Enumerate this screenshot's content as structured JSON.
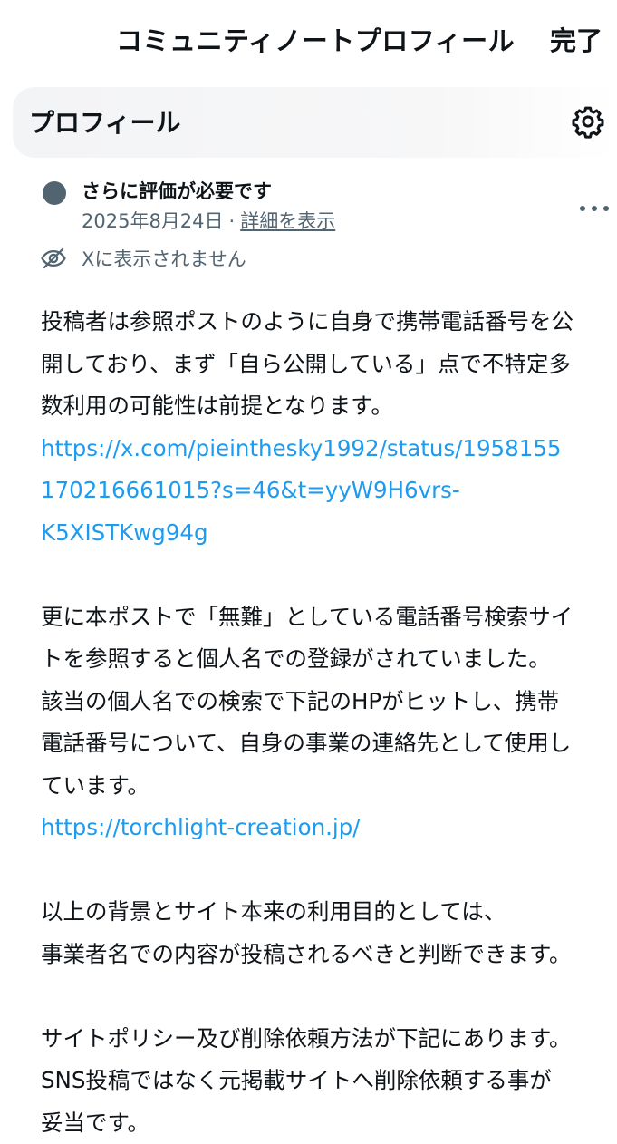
{
  "header": {
    "title": "コミュニティノートプロフィール",
    "done_label": "完了"
  },
  "profile": {
    "title": "プロフィール"
  },
  "note": {
    "status": "さらに評価が必要です",
    "date": "2025年8月24日",
    "separator": "·",
    "details_link": "詳細を表示",
    "visibility": "Xに表示されません",
    "body": {
      "p1": [
        "投稿者は参照ポストのように自身で携帯電話番号を公",
        "開しており、まず「自ら公開している」点で不特定多",
        "数利用の可能性は前提となります。"
      ],
      "link1": [
        "https://x.com/pieinthesky1992/status/1958155",
        "170216661015?s=46&t=yyW9H6vrs-",
        "K5XISTKwg94g"
      ],
      "p2": [
        "更に本ポストで「無難」としている電話番号検索サイ",
        "トを参照すると個人名での登録がされていました。",
        "該当の個人名での検索で下記のHPがヒットし、携帯",
        "電話番号について、自身の事業の連絡先として使用し",
        "ています。"
      ],
      "link2": "https://torchlight-creation.jp/",
      "p3": [
        "以上の背景とサイト本来の利用目的としては、",
        "事業者名での内容が投稿されるべきと判断できます。"
      ],
      "p4": [
        "サイトポリシー及び削除依頼方法が下記にあります。",
        "SNS投稿ではなく元掲載サイトへ削除依頼する事が",
        "妥当です。"
      ]
    }
  },
  "colors": {
    "text": "#0f1419",
    "secondary": "#536471",
    "link": "#1d9bf0",
    "header_bg": "#f3f4f6"
  },
  "icons": [
    "gear-icon",
    "more-horizontal-icon",
    "eye-off-icon",
    "status-dot-icon"
  ]
}
